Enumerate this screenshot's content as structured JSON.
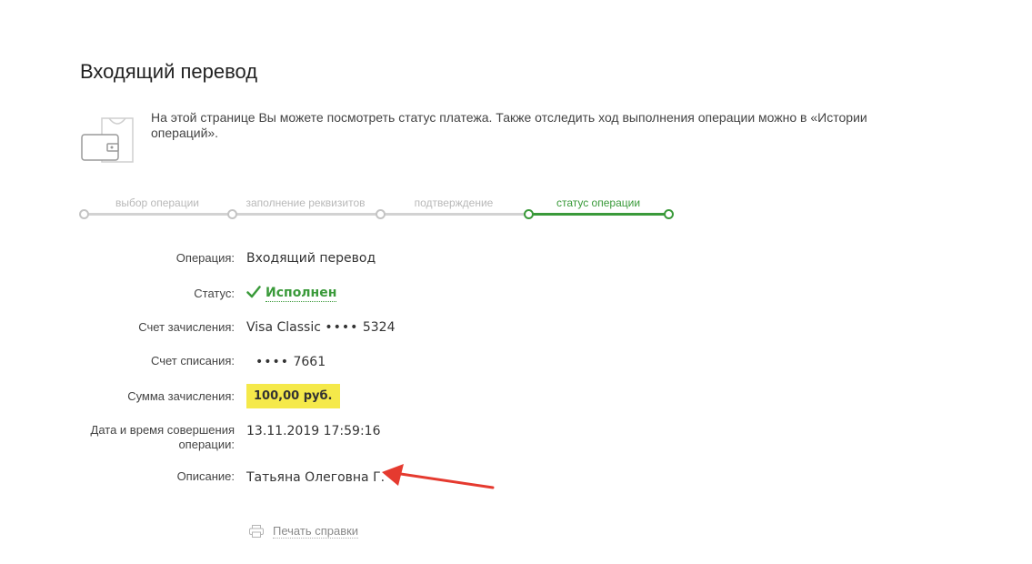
{
  "page": {
    "title": "Входящий перевод",
    "intro_text": "На этой странице Вы можете посмотреть статус платежа. Также отследить ход выполнения операции можно в «Истории операций»."
  },
  "steps": [
    {
      "label": "выбор операции",
      "active": false
    },
    {
      "label": "заполнение реквизитов",
      "active": false
    },
    {
      "label": "подтверждение",
      "active": false
    },
    {
      "label": "статус операции",
      "active": true
    }
  ],
  "details": {
    "operation_label": "Операция:",
    "operation_value": "Входящий перевод",
    "status_label": "Статус:",
    "status_value": "Исполнен",
    "credit_account_label": "Счет зачисления:",
    "credit_account_value": "Visa Classic",
    "credit_account_mask": "••••",
    "credit_account_last4": "5324",
    "debit_account_label": "Счет списания:",
    "debit_account_mask": "••••",
    "debit_account_last4": "7661",
    "amount_label": "Сумма зачисления:",
    "amount_value": "100,00 руб.",
    "datetime_label_line1": "Дата и время совершения",
    "datetime_label_line2": "операции:",
    "datetime_value": "13.11.2019 17:59:16",
    "description_label": "Описание:",
    "description_value": "Татьяна Олеговна Г."
  },
  "actions": {
    "print_label": "Печать справки"
  },
  "colors": {
    "accent_green": "#3a9a3a",
    "highlight_yellow": "#f5e94a",
    "arrow_red": "#e53a2f"
  },
  "icons": [
    "wallet-icon",
    "checkmark-icon",
    "printer-icon",
    "red-arrow-annotation"
  ]
}
